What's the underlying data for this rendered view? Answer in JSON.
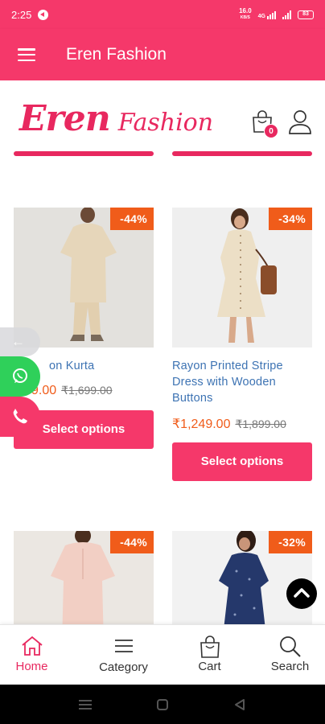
{
  "status_bar": {
    "time": "2:25",
    "net_speed": "16.0",
    "net_unit": "KB/S",
    "net_type": "4G",
    "battery": "83"
  },
  "app_bar": {
    "title": "Eren Fashion",
    "menu_icon": "hamburger-menu-icon"
  },
  "site_header": {
    "logo_word1": "Eren",
    "logo_word2": "Fashion",
    "cart_icon": "shopping-bag-icon",
    "cart_count": "0",
    "account_icon": "user-icon"
  },
  "products": [
    {
      "name": "on Kurta",
      "discount": "-44%",
      "sale_price": "9.00",
      "regular_price": "₹1,699.00",
      "button": "Select options",
      "image_colors": {
        "background": "#e3e1dd",
        "garment": "#e6d6ba"
      }
    },
    {
      "name": "Rayon Printed Stripe Dress with Wooden Buttons",
      "discount": "-34%",
      "sale_price": "₹1,249.00",
      "regular_price": "₹1,899.00",
      "button": "Select options",
      "image_colors": {
        "background": "#efefef",
        "garment": "#ecdfc6"
      }
    },
    {
      "discount": "-44%",
      "image_colors": {
        "background": "#ebe7e2",
        "garment": "#f2cfc4"
      }
    },
    {
      "discount": "-32%",
      "image_colors": {
        "background": "#f2f2f2",
        "garment": "#25386b"
      }
    }
  ],
  "floating": {
    "arrow_icon": "arrow-left-icon",
    "arrow_glyph": "←",
    "whatsapp_icon": "whatsapp-icon",
    "phone_icon": "phone-icon",
    "scroll_top_icon": "chevron-up-icon"
  },
  "bottom_nav": [
    {
      "label": "Home",
      "icon": "home-icon",
      "active": true
    },
    {
      "label": "Category",
      "icon": "list-icon",
      "active": false
    },
    {
      "label": "Cart",
      "icon": "shopping-bag-icon",
      "active": false
    },
    {
      "label": "Search",
      "icon": "search-icon",
      "active": false
    }
  ],
  "colors": {
    "brand": "#f5386a",
    "logo": "#e8285f",
    "discount_badge": "#f05c1a",
    "sale_price": "#f05c1a",
    "product_link": "#3d73b3",
    "whatsapp": "#2fd05a"
  }
}
